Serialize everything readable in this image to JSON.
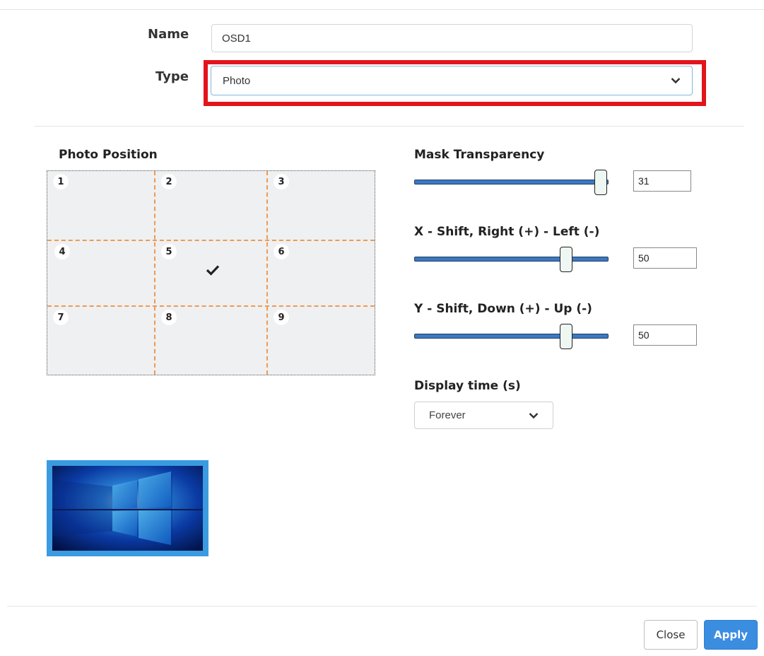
{
  "form": {
    "name_label": "Name",
    "name_value": "OSD1",
    "type_label": "Type",
    "type_value": "Photo"
  },
  "photo_position": {
    "label": "Photo Position",
    "cells": [
      "1",
      "2",
      "3",
      "4",
      "5",
      "6",
      "7",
      "8",
      "9"
    ],
    "selected_cell": "5"
  },
  "mask_transparency": {
    "label": "Mask Transparency",
    "value": "31",
    "level": 1.0
  },
  "x_shift": {
    "label": "X - Shift, Right (+) - Left (-)",
    "value": "50",
    "level": 0.79
  },
  "y_shift": {
    "label": "Y - Shift, Down (+) - Up (-)",
    "value": "50",
    "level": 0.79
  },
  "display_time": {
    "label": "Display time (s)",
    "value": "Forever"
  },
  "footer": {
    "close_label": "Close",
    "apply_label": "Apply"
  },
  "colors": {
    "highlight": "#e3141b",
    "grid_lines": "#ef9a52",
    "slider": "#3d78c0",
    "apply_button": "#3b8de0"
  },
  "icons": [
    "chevron-down-icon",
    "checkmark-icon",
    "photo-thumbnail"
  ]
}
